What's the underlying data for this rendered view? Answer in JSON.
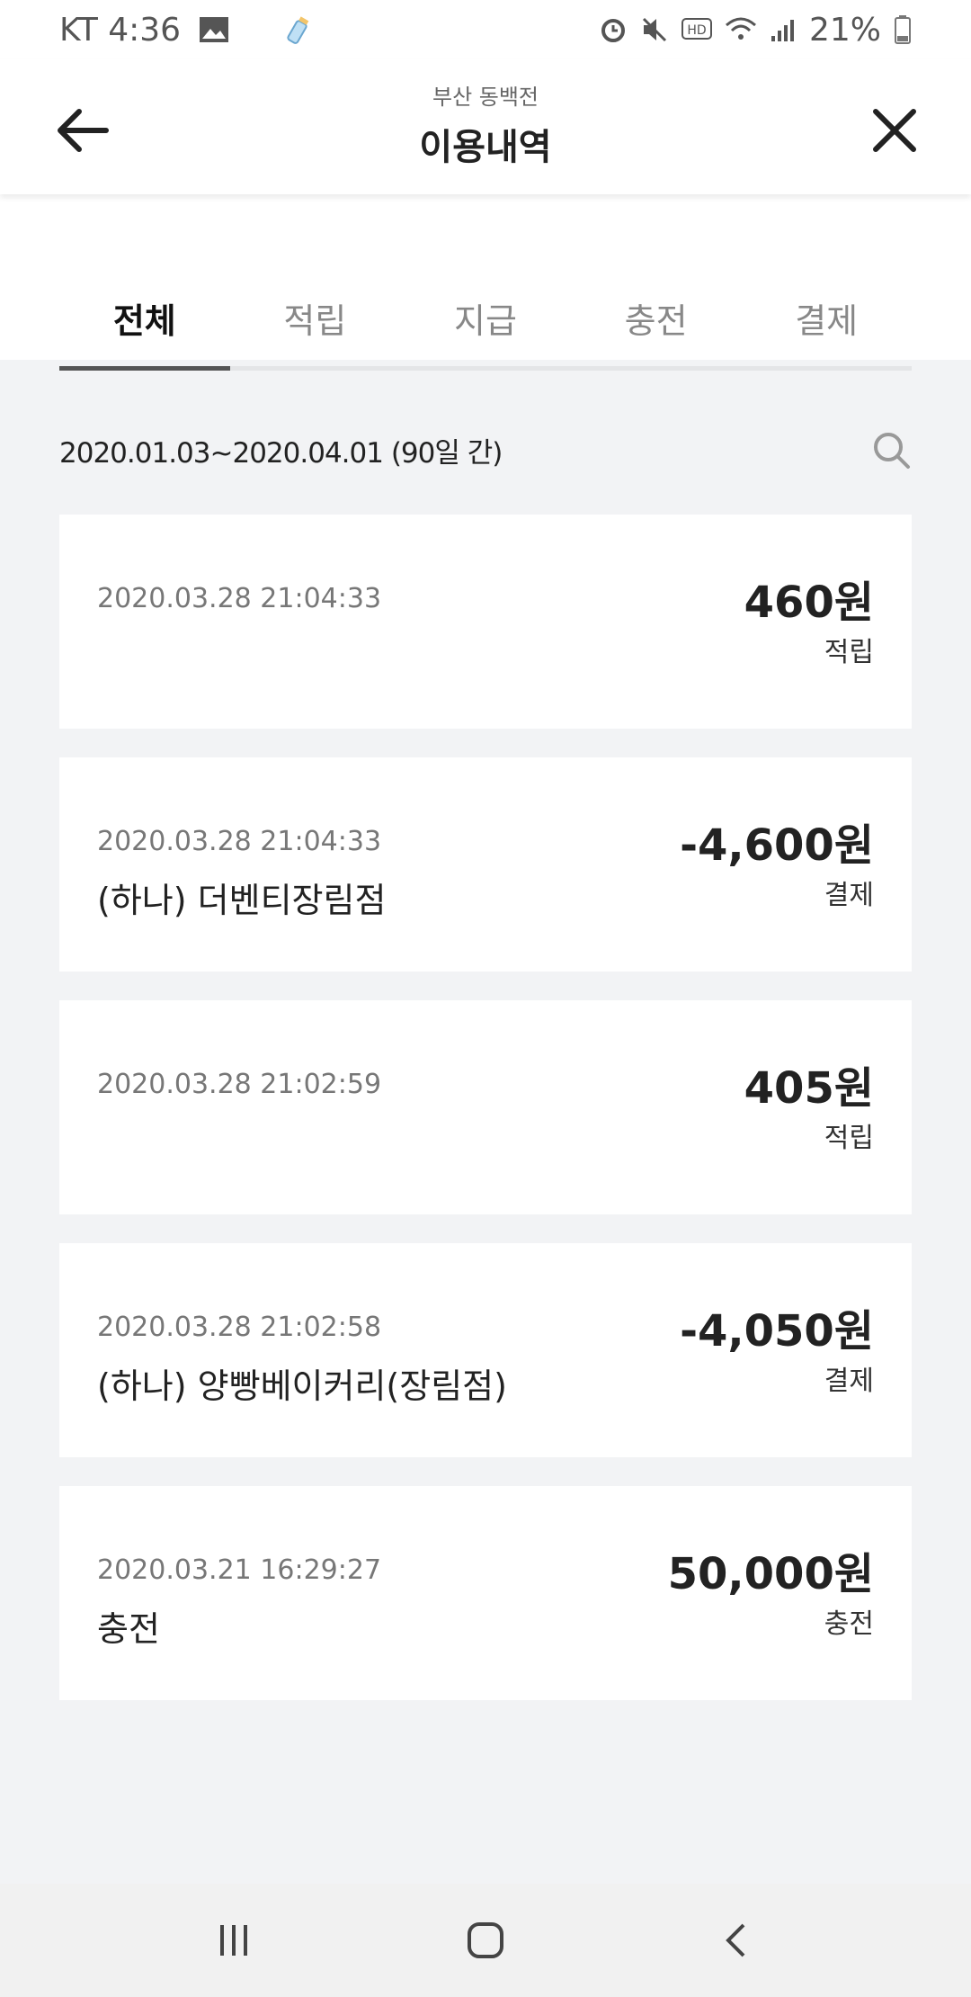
{
  "status_bar": {
    "carrier_time": "KT 4:36",
    "battery": "21%",
    "icons": [
      "image-icon",
      "baby-bottle-icon",
      "alarm-icon",
      "mute-icon",
      "hd-icon",
      "wifi-icon",
      "signal-icon",
      "battery-icon"
    ]
  },
  "header": {
    "subtitle": "부산 동백전",
    "title": "이용내역"
  },
  "tabs": [
    {
      "label": "전체",
      "active": true
    },
    {
      "label": "적립",
      "active": false
    },
    {
      "label": "지급",
      "active": false
    },
    {
      "label": "충전",
      "active": false
    },
    {
      "label": "결제",
      "active": false
    }
  ],
  "period": {
    "text": "2020.01.03~2020.04.01 (90일 간)"
  },
  "transactions": [
    {
      "datetime": "2020.03.28 21:04:33",
      "merchant": "",
      "amount": "460원",
      "type": "적립"
    },
    {
      "datetime": "2020.03.28 21:04:33",
      "merchant": "(하나) 더벤티장림점",
      "amount": "-4,600원",
      "type": "결제"
    },
    {
      "datetime": "2020.03.28 21:02:59",
      "merchant": "",
      "amount": "405원",
      "type": "적립"
    },
    {
      "datetime": "2020.03.28 21:02:58",
      "merchant": "(하나) 양빵베이커리(장림점)",
      "amount": "-4,050원",
      "type": "결제"
    },
    {
      "datetime": "2020.03.21 16:29:27",
      "merchant": "충전",
      "amount": "50,000원",
      "type": "충전"
    }
  ],
  "nav_bar": {
    "icons": [
      "recent-apps-icon",
      "home-icon",
      "back-nav-icon"
    ]
  }
}
